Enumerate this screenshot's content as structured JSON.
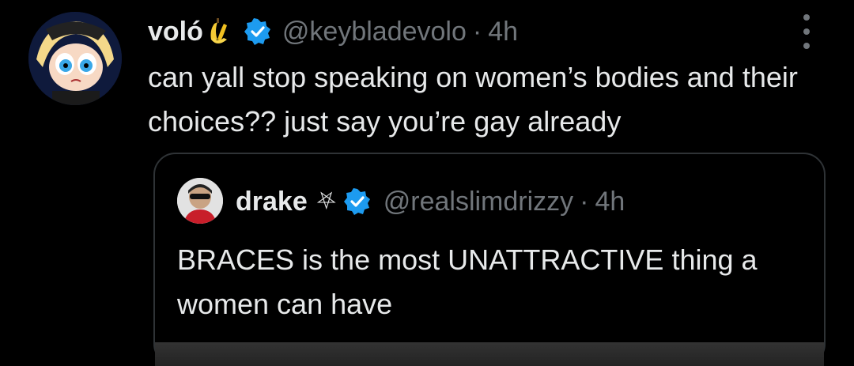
{
  "tweet": {
    "display_name": "voló",
    "name_emoji": "banana-emoji",
    "handle": "@keybladevolo",
    "separator": "·",
    "time": "4h",
    "text": "can yall stop speaking on women’s bodies and their choices?? just say you’re gay already",
    "verified_color": "#1d9bf0"
  },
  "quote": {
    "display_name": "drake",
    "name_glyph": "⛧",
    "handle": "@realslimdrizzy",
    "separator": "·",
    "time": "4h",
    "text": "BRACES is the most UNATTRACTIVE thing a women can have"
  },
  "colors": {
    "background": "#000000",
    "text": "#e7e9ea",
    "secondary": "#71767b",
    "border": "#2f3336"
  }
}
